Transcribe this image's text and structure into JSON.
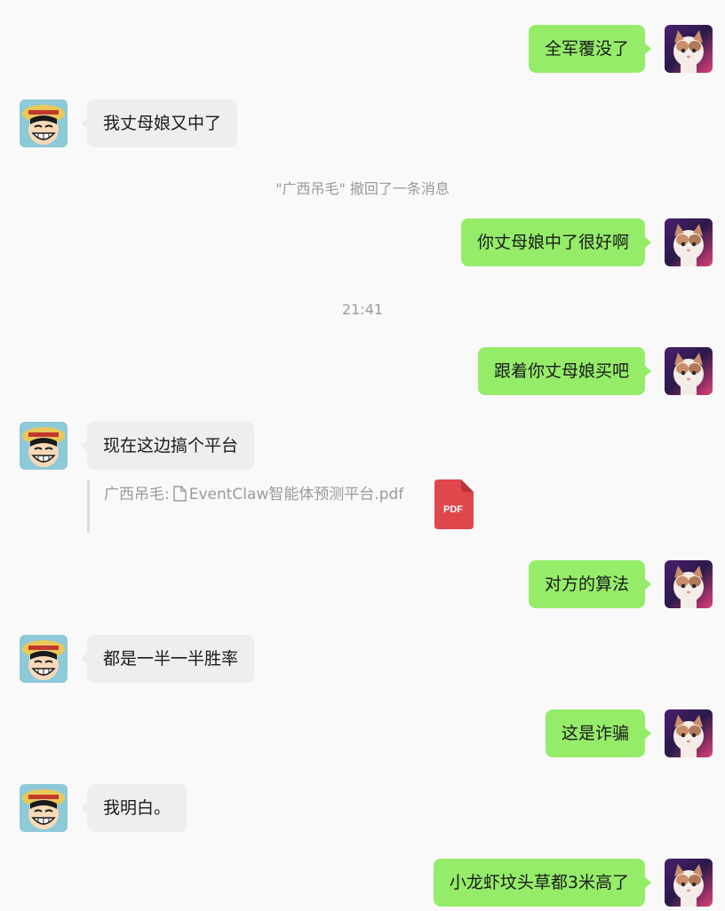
{
  "colors": {
    "background": "#f9f9fa",
    "my_bubble": "#95ec69",
    "their_bubble": "#eeeef0",
    "system_text": "#9a9a9a",
    "pdf_red": "#e0474c"
  },
  "participants": {
    "me": {
      "avatar": "cat-avatar-icon"
    },
    "them": {
      "avatar": "straw-hat-avatar-icon"
    }
  },
  "messages": [
    {
      "sender": "me",
      "text": "全军覆没了"
    },
    {
      "sender": "them",
      "text": "我丈母娘又中了"
    },
    {
      "type": "system",
      "text": "\"广西吊毛\" 撤回了一条消息"
    },
    {
      "sender": "me",
      "text": "你丈母娘中了很好啊"
    },
    {
      "type": "timestamp",
      "text": "21:41"
    },
    {
      "sender": "me",
      "text": "跟着你丈母娘买吧"
    },
    {
      "sender": "them",
      "text": "现在这边搞个平台"
    },
    {
      "type": "quote",
      "quoted_sender": "广西吊毛:",
      "file_name": "EventClaw智能体预测平台.pdf",
      "file_icon": "pdf-icon",
      "file_badge": "PDF"
    },
    {
      "sender": "me",
      "text": "对方的算法"
    },
    {
      "sender": "them",
      "text": "都是一半一半胜率"
    },
    {
      "sender": "me",
      "text": "这是诈骗"
    },
    {
      "sender": "them",
      "text": "我明白。"
    },
    {
      "sender": "me",
      "text": "小龙虾坟头草都3米高了"
    }
  ]
}
